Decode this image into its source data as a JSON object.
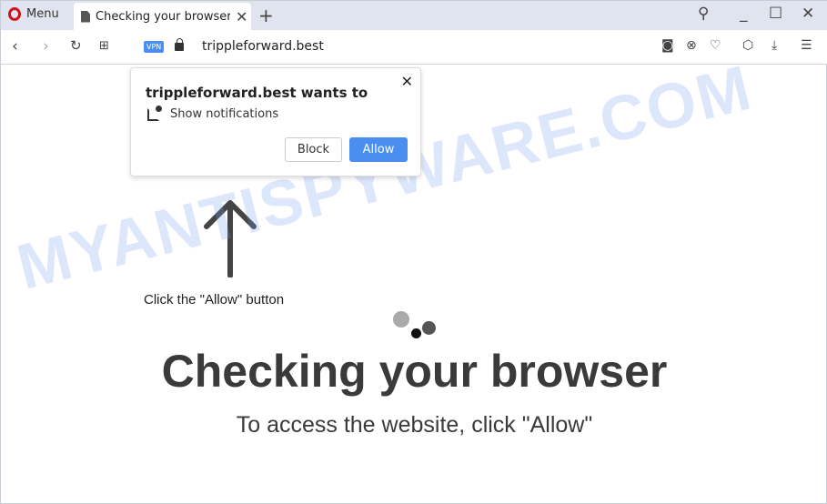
{
  "browser": {
    "menu_label": "Menu",
    "tab_title": "Checking your browser",
    "url": "trippleforward.best",
    "vpn_label": "VPN"
  },
  "popup": {
    "title": "trippleforward.best wants to",
    "permission": "Show notifications",
    "block_label": "Block",
    "allow_label": "Allow"
  },
  "page": {
    "hint": "Click the \"Allow\" button",
    "heading": "Checking your browser",
    "subheading": "To access the website, click \"Allow\""
  },
  "watermark": "MYANTISPYWARE.COM",
  "colors": {
    "accent": "#4a8ff0",
    "opera_red": "#d0101d"
  }
}
